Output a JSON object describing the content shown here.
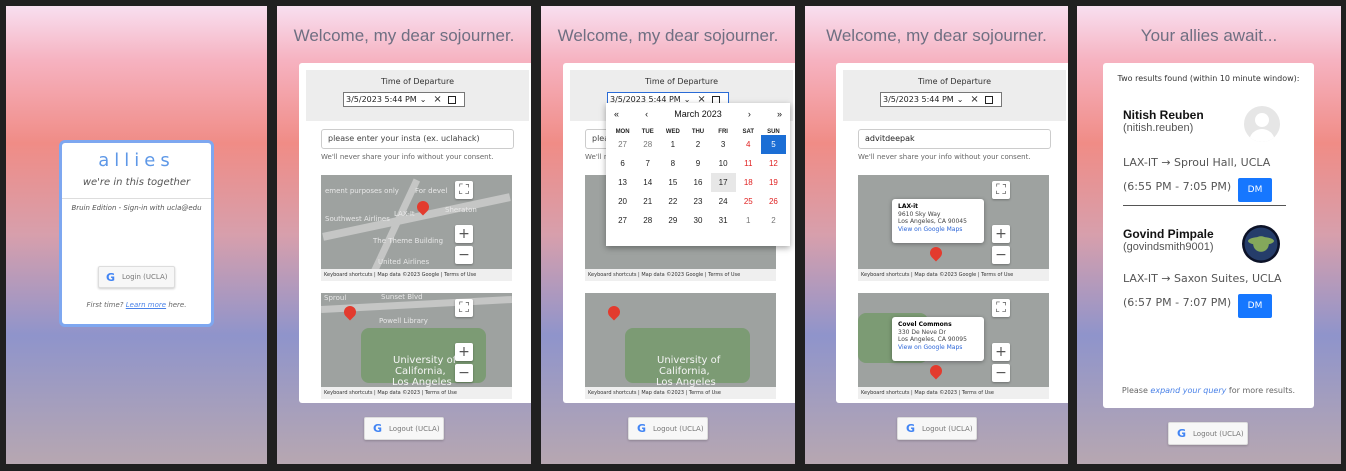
{
  "screen1": {
    "brand": "allies",
    "tagline": "we're in this together",
    "edition": "Bruin Edition - Sign-in with ucla@edu",
    "login_label": "Login (UCLA)",
    "first_time": "First time?",
    "learn_more": "Learn more",
    "here": "here."
  },
  "form": {
    "welcome": "Welcome, my dear sojourner.",
    "departure_label": "Time of Departure",
    "datetime": "3/5/2023 5:44  PM",
    "clear_icon": "×",
    "insta_placeholder": "please enter your insta (ex. uclahack)",
    "insta_value": "advitdeepak",
    "privacy": "We'll never share your info without your consent.",
    "logout_label": "Logout (UCLA)"
  },
  "maps": {
    "map1_labels": [
      "ement purposes only",
      "For devel",
      "Southwest Airlines",
      "LAX-It",
      "Sheraton",
      "The Theme Building",
      "United Airlines",
      "Keyboard shortcuts",
      "Map data ©2023 Google",
      "Terms of Use"
    ],
    "map2_labels": [
      "Sproul",
      "Sunset Blvd",
      "Powell Library",
      "University of",
      "California,",
      "Los Angeles",
      "Keyboard shortcuts",
      "Map data ©2023",
      "Terms of Use"
    ],
    "popup1": {
      "name": "LAX-it",
      "address1": "9610 Sky Way",
      "address2": "Los Angeles, CA 90045",
      "link": "View on Google Maps"
    },
    "popup2": {
      "name": "Covel Commons",
      "address1": "330 De Neve Dr",
      "address2": "Los Angeles, CA 90095",
      "link": "View on Google Maps"
    }
  },
  "calendar": {
    "month": "March 2023",
    "nav": [
      "«",
      "‹",
      "›",
      "»"
    ],
    "days": [
      "MON",
      "TUE",
      "WED",
      "THU",
      "FRI",
      "SAT",
      "SUN"
    ],
    "weeks": [
      [
        "27",
        "28",
        "1",
        "2",
        "3",
        "4",
        "5"
      ],
      [
        "6",
        "7",
        "8",
        "9",
        "10",
        "11",
        "12"
      ],
      [
        "13",
        "14",
        "15",
        "16",
        "17",
        "18",
        "19"
      ],
      [
        "20",
        "21",
        "22",
        "23",
        "24",
        "25",
        "26"
      ],
      [
        "27",
        "28",
        "29",
        "30",
        "31",
        "1",
        "2"
      ]
    ]
  },
  "results": {
    "title": "Your allies await...",
    "found": "Two results found (within 10 minute window):",
    "people": [
      {
        "name": "Nitish Reuben",
        "handle": "(nitish.reuben)",
        "route": "LAX-IT → Sproul Hall, UCLA",
        "time": "(6:55 PM - 7:05 PM)",
        "dm": "DM"
      },
      {
        "name": "Govind Pimpale",
        "handle": "(govindsmith9001)",
        "route": "LAX-IT → Saxon Suites, UCLA",
        "time": "(6:57 PM - 7:07 PM)",
        "dm": "DM"
      }
    ],
    "please": "Please",
    "expand": "expand your query",
    "more": "for more results."
  },
  "colors": {
    "accent": "#1677ff",
    "brand": "#5e98e7"
  }
}
